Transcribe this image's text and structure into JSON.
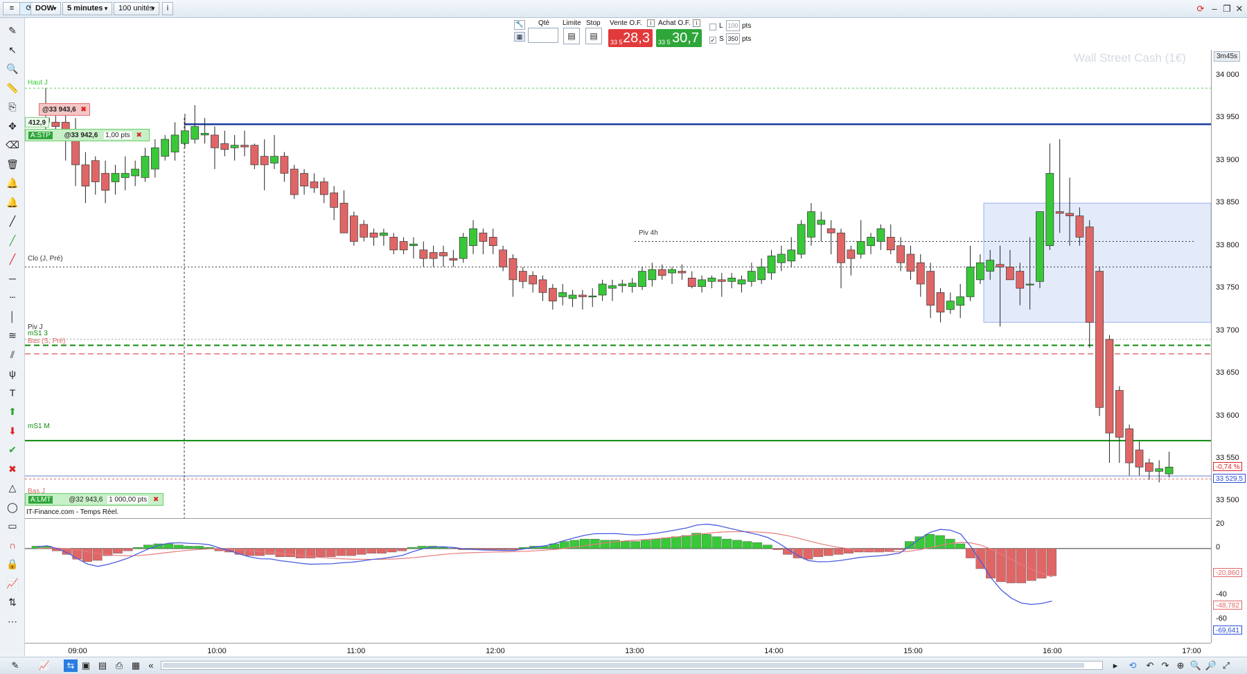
{
  "toolbar": {
    "symbol": "DOW",
    "timeframe": "5 minutes",
    "units": "100 unités"
  },
  "order_panel": {
    "qty_label": "Qté",
    "limit_label": "Limite",
    "stop_label": "Stop",
    "sell_label": "Vente O.F.",
    "buy_label": "Achat O.F.",
    "sell_prefix": "33 5",
    "sell_price": "28,3",
    "buy_prefix": "33 5",
    "buy_price": "30,7",
    "l_label": "L",
    "l_value": "100",
    "l_unit": "pts",
    "s_label": "S",
    "s_value": "350",
    "s_unit": "pts"
  },
  "chart": {
    "instrument_watermark": "Wall Street Cash (1€)",
    "countdown": "3m45s",
    "source": "IT-Finance.com - Temps Réel.",
    "levels": {
      "haut_j": "Haut J",
      "clo": "Clo (J, Pré)",
      "piv_4h": "Piv 4h",
      "piv_j": "Piv J",
      "ms1_3": "mS1 3",
      "bas_s": "Bas (S, Pré)",
      "ms1_m": "mS1 M",
      "bas_j": "Bas J"
    },
    "orders": {
      "stop_tag": "A:STP",
      "stop_price": "@33 942,6",
      "stop_size": "1,00 pts",
      "stop_top_price": "@33 943,6",
      "distance": "412,9",
      "limit_tag": "A:LMT",
      "limit_price": "@32 943,6",
      "limit_size": "1 000,00 pts"
    },
    "price_ticks": [
      "34 000",
      "33 950",
      "33 900",
      "33 850",
      "33 800",
      "33 750",
      "33 700",
      "33 650",
      "33 600",
      "33 550",
      "33 500"
    ],
    "change_tag": "-0,74 %",
    "last_price_tag": "33 529,5",
    "indicator_ticks": [
      "20",
      "0",
      "-40",
      "-60"
    ],
    "indicator_tags": [
      "-20,860",
      "-48,782",
      "-69,641"
    ],
    "time_ticks": [
      "09:00",
      "10:00",
      "11:00",
      "12:00",
      "13:00",
      "14:00",
      "15:00",
      "16:00",
      "17:00"
    ]
  },
  "chart_data": {
    "type": "candlestick",
    "timeframe": "5 minutes",
    "ylim": [
      33480,
      34030
    ],
    "y_ticks": [
      34000,
      33950,
      33900,
      33850,
      33800,
      33750,
      33700,
      33650,
      33600,
      33550,
      33500
    ],
    "x_ticks": [
      "09:00",
      "10:00",
      "11:00",
      "12:00",
      "13:00",
      "14:00",
      "15:00",
      "16:00",
      "17:00"
    ],
    "candles": [
      {
        "o": 33950,
        "h": 33985,
        "l": 33935,
        "c": 33945
      },
      {
        "o": 33945,
        "h": 33965,
        "l": 33925,
        "c": 33940
      },
      {
        "o": 33945,
        "h": 33955,
        "l": 33900,
        "c": 33935
      },
      {
        "o": 33935,
        "h": 33950,
        "l": 33870,
        "c": 33895
      },
      {
        "o": 33895,
        "h": 33910,
        "l": 33850,
        "c": 33870
      },
      {
        "o": 33900,
        "h": 33905,
        "l": 33860,
        "c": 33875
      },
      {
        "o": 33885,
        "h": 33900,
        "l": 33850,
        "c": 33865
      },
      {
        "o": 33875,
        "h": 33895,
        "l": 33860,
        "c": 33885
      },
      {
        "o": 33880,
        "h": 33905,
        "l": 33865,
        "c": 33885
      },
      {
        "o": 33882,
        "h": 33900,
        "l": 33870,
        "c": 33890
      },
      {
        "o": 33880,
        "h": 33915,
        "l": 33875,
        "c": 33905
      },
      {
        "o": 33890,
        "h": 33925,
        "l": 33880,
        "c": 33915
      },
      {
        "o": 33905,
        "h": 33930,
        "l": 33900,
        "c": 33925
      },
      {
        "o": 33910,
        "h": 33945,
        "l": 33900,
        "c": 33930
      },
      {
        "o": 33920,
        "h": 33955,
        "l": 33915,
        "c": 33935
      },
      {
        "o": 33925,
        "h": 33965,
        "l": 33920,
        "c": 33940
      },
      {
        "o": 33930,
        "h": 33950,
        "l": 33920,
        "c": 33932
      },
      {
        "o": 33930,
        "h": 33940,
        "l": 33890,
        "c": 33915
      },
      {
        "o": 33920,
        "h": 33935,
        "l": 33905,
        "c": 33913
      },
      {
        "o": 33915,
        "h": 33930,
        "l": 33900,
        "c": 33918
      },
      {
        "o": 33918,
        "h": 33935,
        "l": 33905,
        "c": 33916
      },
      {
        "o": 33918,
        "h": 33920,
        "l": 33890,
        "c": 33895
      },
      {
        "o": 33905,
        "h": 33925,
        "l": 33865,
        "c": 33895
      },
      {
        "o": 33897,
        "h": 33930,
        "l": 33890,
        "c": 33905
      },
      {
        "o": 33905,
        "h": 33910,
        "l": 33875,
        "c": 33885
      },
      {
        "o": 33890,
        "h": 33895,
        "l": 33855,
        "c": 33860
      },
      {
        "o": 33885,
        "h": 33890,
        "l": 33860,
        "c": 33870
      },
      {
        "o": 33875,
        "h": 33885,
        "l": 33862,
        "c": 33868
      },
      {
        "o": 33875,
        "h": 33880,
        "l": 33850,
        "c": 33860
      },
      {
        "o": 33862,
        "h": 33870,
        "l": 33830,
        "c": 33845
      },
      {
        "o": 33850,
        "h": 33865,
        "l": 33815,
        "c": 33815
      },
      {
        "o": 33835,
        "h": 33840,
        "l": 33800,
        "c": 33805
      },
      {
        "o": 33825,
        "h": 33830,
        "l": 33805,
        "c": 33810
      },
      {
        "o": 33815,
        "h": 33820,
        "l": 33800,
        "c": 33810
      },
      {
        "o": 33812,
        "h": 33820,
        "l": 33800,
        "c": 33815
      },
      {
        "o": 33810,
        "h": 33815,
        "l": 33790,
        "c": 33795
      },
      {
        "o": 33805,
        "h": 33810,
        "l": 33790,
        "c": 33795
      },
      {
        "o": 33800,
        "h": 33810,
        "l": 33785,
        "c": 33802
      },
      {
        "o": 33795,
        "h": 33805,
        "l": 33775,
        "c": 33785
      },
      {
        "o": 33792,
        "h": 33800,
        "l": 33775,
        "c": 33785
      },
      {
        "o": 33792,
        "h": 33800,
        "l": 33775,
        "c": 33788
      },
      {
        "o": 33785,
        "h": 33795,
        "l": 33775,
        "c": 33783
      },
      {
        "o": 33785,
        "h": 33815,
        "l": 33780,
        "c": 33810
      },
      {
        "o": 33800,
        "h": 33830,
        "l": 33790,
        "c": 33820
      },
      {
        "o": 33815,
        "h": 33820,
        "l": 33790,
        "c": 33805
      },
      {
        "o": 33810,
        "h": 33820,
        "l": 33790,
        "c": 33800
      },
      {
        "o": 33795,
        "h": 33800,
        "l": 33770,
        "c": 33775
      },
      {
        "o": 33785,
        "h": 33790,
        "l": 33740,
        "c": 33760
      },
      {
        "o": 33770,
        "h": 33775,
        "l": 33750,
        "c": 33758
      },
      {
        "o": 33765,
        "h": 33770,
        "l": 33745,
        "c": 33755
      },
      {
        "o": 33760,
        "h": 33765,
        "l": 33735,
        "c": 33745
      },
      {
        "o": 33750,
        "h": 33755,
        "l": 33725,
        "c": 33735
      },
      {
        "o": 33740,
        "h": 33755,
        "l": 33730,
        "c": 33745
      },
      {
        "o": 33738,
        "h": 33748,
        "l": 33728,
        "c": 33742
      },
      {
        "o": 33742,
        "h": 33748,
        "l": 33725,
        "c": 33740
      },
      {
        "o": 33740,
        "h": 33750,
        "l": 33728,
        "c": 33741
      },
      {
        "o": 33742,
        "h": 33760,
        "l": 33735,
        "c": 33755
      },
      {
        "o": 33750,
        "h": 33760,
        "l": 33735,
        "c": 33753
      },
      {
        "o": 33753,
        "h": 33760,
        "l": 33745,
        "c": 33755
      },
      {
        "o": 33752,
        "h": 33762,
        "l": 33745,
        "c": 33756
      },
      {
        "o": 33752,
        "h": 33775,
        "l": 33748,
        "c": 33770
      },
      {
        "o": 33760,
        "h": 33780,
        "l": 33752,
        "c": 33772
      },
      {
        "o": 33772,
        "h": 33778,
        "l": 33760,
        "c": 33765
      },
      {
        "o": 33768,
        "h": 33775,
        "l": 33755,
        "c": 33772
      },
      {
        "o": 33770,
        "h": 33778,
        "l": 33760,
        "c": 33768
      },
      {
        "o": 33762,
        "h": 33770,
        "l": 33750,
        "c": 33752
      },
      {
        "o": 33752,
        "h": 33765,
        "l": 33745,
        "c": 33760
      },
      {
        "o": 33758,
        "h": 33765,
        "l": 33750,
        "c": 33762
      },
      {
        "o": 33760,
        "h": 33768,
        "l": 33740,
        "c": 33758
      },
      {
        "o": 33758,
        "h": 33768,
        "l": 33750,
        "c": 33762
      },
      {
        "o": 33755,
        "h": 33765,
        "l": 33745,
        "c": 33760
      },
      {
        "o": 33758,
        "h": 33780,
        "l": 33752,
        "c": 33770
      },
      {
        "o": 33760,
        "h": 33785,
        "l": 33755,
        "c": 33775
      },
      {
        "o": 33768,
        "h": 33795,
        "l": 33760,
        "c": 33788
      },
      {
        "o": 33780,
        "h": 33800,
        "l": 33770,
        "c": 33790
      },
      {
        "o": 33782,
        "h": 33810,
        "l": 33775,
        "c": 33795
      },
      {
        "o": 33790,
        "h": 33830,
        "l": 33785,
        "c": 33825
      },
      {
        "o": 33810,
        "h": 33850,
        "l": 33800,
        "c": 33840
      },
      {
        "o": 33825,
        "h": 33840,
        "l": 33805,
        "c": 33830
      },
      {
        "o": 33820,
        "h": 33830,
        "l": 33790,
        "c": 33815
      },
      {
        "o": 33815,
        "h": 33820,
        "l": 33750,
        "c": 33780
      },
      {
        "o": 33795,
        "h": 33800,
        "l": 33765,
        "c": 33785
      },
      {
        "o": 33790,
        "h": 33830,
        "l": 33785,
        "c": 33805
      },
      {
        "o": 33800,
        "h": 33815,
        "l": 33790,
        "c": 33810
      },
      {
        "o": 33805,
        "h": 33825,
        "l": 33795,
        "c": 33820
      },
      {
        "o": 33810,
        "h": 33825,
        "l": 33790,
        "c": 33795
      },
      {
        "o": 33800,
        "h": 33810,
        "l": 33770,
        "c": 33780
      },
      {
        "o": 33790,
        "h": 33800,
        "l": 33760,
        "c": 33770
      },
      {
        "o": 33780,
        "h": 33790,
        "l": 33740,
        "c": 33755
      },
      {
        "o": 33770,
        "h": 33780,
        "l": 33715,
        "c": 33730
      },
      {
        "o": 33745,
        "h": 33750,
        "l": 33710,
        "c": 33722
      },
      {
        "o": 33725,
        "h": 33745,
        "l": 33720,
        "c": 33735
      },
      {
        "o": 33730,
        "h": 33755,
        "l": 33715,
        "c": 33740
      },
      {
        "o": 33740,
        "h": 33800,
        "l": 33735,
        "c": 33775
      },
      {
        "o": 33760,
        "h": 33790,
        "l": 33755,
        "c": 33780
      },
      {
        "o": 33770,
        "h": 33795,
        "l": 33760,
        "c": 33783
      },
      {
        "o": 33778,
        "h": 33800,
        "l": 33705,
        "c": 33775
      },
      {
        "o": 33775,
        "h": 33795,
        "l": 33760,
        "c": 33760
      },
      {
        "o": 33770,
        "h": 33780,
        "l": 33730,
        "c": 33750
      },
      {
        "o": 33755,
        "h": 33810,
        "l": 33725,
        "c": 33755
      },
      {
        "o": 33758,
        "h": 33830,
        "l": 33750,
        "c": 33840
      },
      {
        "o": 33800,
        "h": 33920,
        "l": 33795,
        "c": 33885
      },
      {
        "o": 33840,
        "h": 33925,
        "l": 33815,
        "c": 33838
      },
      {
        "o": 33838,
        "h": 33880,
        "l": 33800,
        "c": 33835
      },
      {
        "o": 33835,
        "h": 33845,
        "l": 33800,
        "c": 33810
      },
      {
        "o": 33822,
        "h": 33830,
        "l": 33680,
        "c": 33710
      },
      {
        "o": 33770,
        "h": 33775,
        "l": 33600,
        "c": 33610
      },
      {
        "o": 33690,
        "h": 33695,
        "l": 33545,
        "c": 33580
      },
      {
        "o": 33630,
        "h": 33635,
        "l": 33545,
        "c": 33575
      },
      {
        "o": 33585,
        "h": 33590,
        "l": 33530,
        "c": 33545
      },
      {
        "o": 33560,
        "h": 33570,
        "l": 33530,
        "c": 33540
      },
      {
        "o": 33545,
        "h": 33550,
        "l": 33525,
        "c": 33535
      },
      {
        "o": 33535,
        "h": 33548,
        "l": 33522,
        "c": 33538
      },
      {
        "o": 33532,
        "h": 33558,
        "l": 33528,
        "c": 33540
      }
    ],
    "levels": [
      {
        "name": "Haut J",
        "value": 33985
      },
      {
        "name": "Clo (J, Pré)",
        "value": 33775
      },
      {
        "name": "Piv 4h",
        "value": 33805
      },
      {
        "name": "Piv J",
        "value": 33690
      },
      {
        "name": "mS1 3",
        "value": 33683
      },
      {
        "name": "Bas (S, Pré)",
        "value": 33673
      },
      {
        "name": "mS1 M",
        "value": 33571
      },
      {
        "name": "Bas J",
        "value": 33526
      }
    ],
    "stop_order_level": 33942.6,
    "last_price": 33529.5,
    "change_percent": -0.74,
    "indicator": {
      "ylim": [
        -80,
        25
      ],
      "y_ticks": [
        20,
        0,
        -40,
        -60
      ],
      "tags": [
        -20.86,
        -48.782,
        -69.641
      ],
      "histogram": [
        2,
        2,
        -2,
        -5,
        -9,
        -11,
        -10,
        -6,
        -4,
        -2,
        1,
        3,
        4,
        4,
        3,
        2,
        2,
        1,
        -2,
        -3,
        -5,
        -6,
        -6,
        -5,
        -7,
        -7,
        -8,
        -8,
        -7,
        -7,
        -6,
        -6,
        -5,
        -4,
        -4,
        -3,
        -2,
        1,
        2,
        2,
        1,
        0,
        -1,
        -1,
        -1,
        -1,
        -1,
        -1,
        1,
        2,
        2,
        4,
        6,
        7,
        8,
        8,
        7,
        7,
        6,
        6,
        7,
        8,
        9,
        10,
        11,
        13,
        12,
        10,
        8,
        7,
        6,
        5,
        3,
        -1,
        -5,
        -8,
        -9,
        -7,
        -6,
        -5,
        -4,
        -3,
        -3,
        -3,
        -2,
        -1,
        6,
        10,
        12,
        11,
        8,
        4,
        -8,
        -17,
        -25,
        -28,
        -29,
        -29,
        -27,
        -25,
        -23
      ]
    },
    "colors": {
      "up": "#38c838",
      "down": "#e06666",
      "macd": "#4a5be0",
      "signal": "#e77b7b",
      "stop_line": "#1a3a9b",
      "support_line": "#0a8a0a"
    }
  },
  "bottombar": {
    "zoom_in": "+",
    "zoom_out": "−"
  }
}
